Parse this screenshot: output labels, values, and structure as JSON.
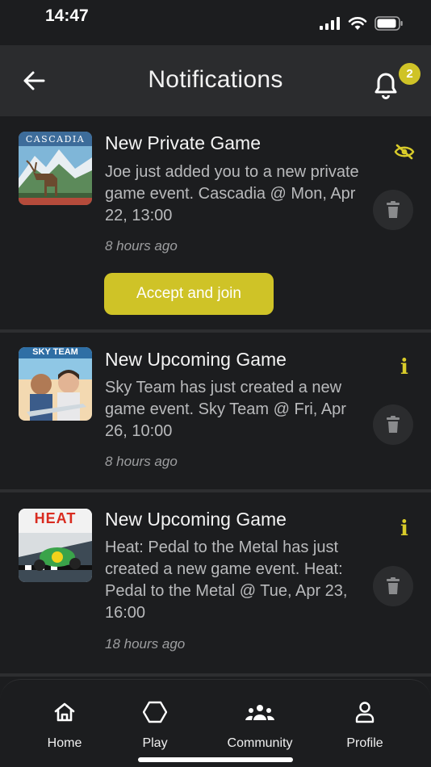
{
  "status_bar": {
    "time": "14:47"
  },
  "header": {
    "title": "Notifications",
    "badge_count": "2"
  },
  "notifications": [
    {
      "title": "New Private Game",
      "body": "Joe  just added you to a new private game event. Cascadia @ Mon, Apr 22, 13:00",
      "time": "8 hours ago",
      "action_icon": "eye-off-icon",
      "button_label": "Accept and join",
      "thumb_text": "CASCADIA"
    },
    {
      "title": "New Upcoming Game",
      "body": "Sky Team has just created a new game event. Sky Team @ Fri, Apr 26, 10:00",
      "time": "8 hours ago",
      "action_icon": "info-icon",
      "thumb_text": "SKY TEAM"
    },
    {
      "title": "New Upcoming Game",
      "body": "Heat: Pedal to the Metal has just created a new game event. Heat: Pedal to the Metal @ Tue, Apr 23, 16:00",
      "time": "18 hours ago",
      "action_icon": "info-icon",
      "thumb_text": "HEAT"
    }
  ],
  "nav": {
    "items": [
      {
        "label": "Home",
        "icon": "home-icon"
      },
      {
        "label": "Play",
        "icon": "hexagon-icon"
      },
      {
        "label": "Community",
        "icon": "community-icon"
      },
      {
        "label": "Profile",
        "icon": "profile-icon"
      }
    ]
  },
  "colors": {
    "accent": "#cfc327",
    "background": "#1c1d1f",
    "surface": "#2b2c2e"
  }
}
